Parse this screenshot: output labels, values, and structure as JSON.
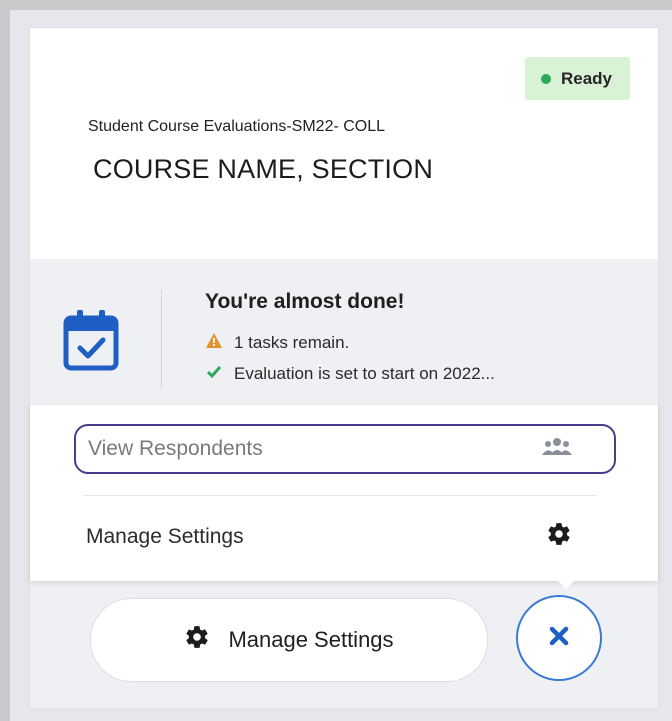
{
  "card": {
    "status": "Ready",
    "evaluation_title": "Student Course Evaluations-SM22- COLL",
    "course_name": "COURSE NAME, SECTION"
  },
  "progress": {
    "title": "You're almost done!",
    "tasks_remaining": "1 tasks remain.",
    "start_notice": "Evaluation is set to start on 2022..."
  },
  "menu": {
    "items": [
      {
        "label": "View Respondents",
        "icon": "people-icon"
      },
      {
        "label": "Manage Settings",
        "icon": "gear-icon"
      }
    ]
  },
  "footer": {
    "manage_label": "Manage Settings",
    "close_icon": "close-icon"
  },
  "colors": {
    "ready_bg": "#d9f2d6",
    "ready_dot": "#2bab58",
    "accent_blue": "#1f5fc4",
    "focus_ring": "#4a3d8c",
    "warning": "#e8912b",
    "check": "#2bab58"
  }
}
